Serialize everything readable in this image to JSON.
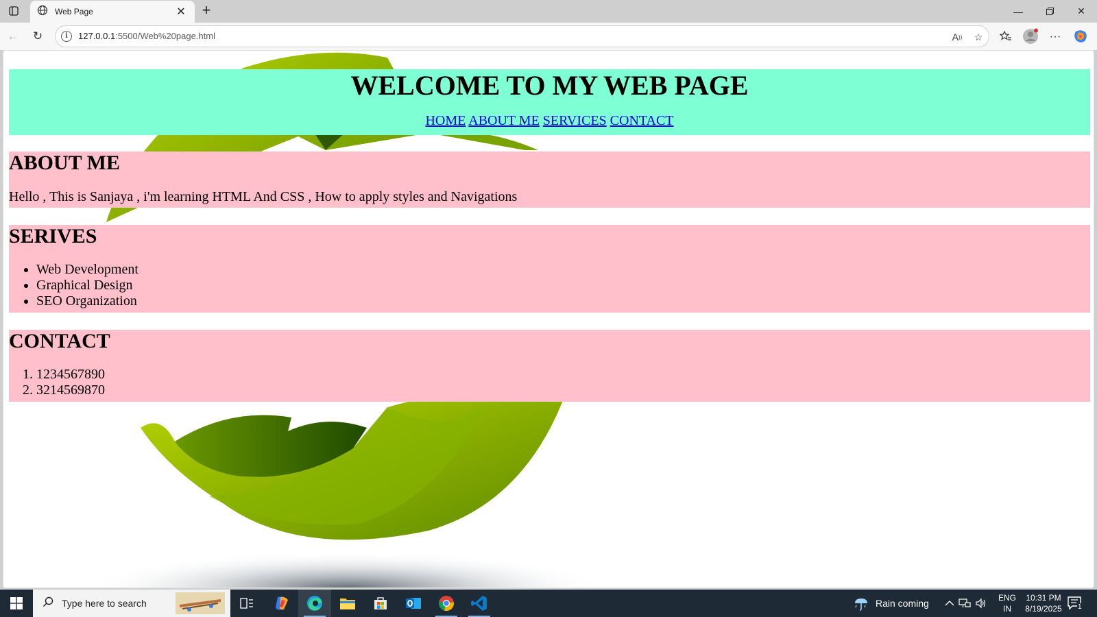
{
  "browser": {
    "tab_title": "Web Page",
    "url_host": "127.0.0.1",
    "url_path": ":5500/Web%20page.html",
    "icons": [
      "tab-actions-icon",
      "globe-icon",
      "close-icon",
      "plus-icon",
      "minimize-icon",
      "restore-icon",
      "back-icon",
      "refresh-icon",
      "info-icon",
      "read-aloud-icon",
      "star-icon",
      "favorites-icon",
      "profile-icon",
      "more-icon",
      "copilot-icon"
    ]
  },
  "page": {
    "header_title": "WELCOME TO MY WEB PAGE",
    "nav": {
      "home": "HOME",
      "about": "ABOUT ME",
      "services": "SERVICES",
      "contact": "CONTACT"
    },
    "about": {
      "heading": "ABOUT ME",
      "text": "Hello , This is Sanjaya , i'm learning HTML And CSS , How to apply styles and Navigations"
    },
    "services": {
      "heading": "SERIVES",
      "items": [
        "Web Development",
        "Graphical Design",
        "SEO Organization"
      ]
    },
    "contact": {
      "heading": "CONTACT",
      "items": [
        "1234567890",
        "3214569870"
      ]
    },
    "colors": {
      "header_bg": "#7fffd4",
      "section_bg": "#ffc0cb",
      "link": "#0000ee"
    }
  },
  "taskbar": {
    "search_placeholder": "Type here to search",
    "weather": "Rain coming",
    "lang_line1": "ENG",
    "lang_line2": "IN",
    "time": "10:31 PM",
    "date": "8/19/2025",
    "notification_count": "1"
  }
}
